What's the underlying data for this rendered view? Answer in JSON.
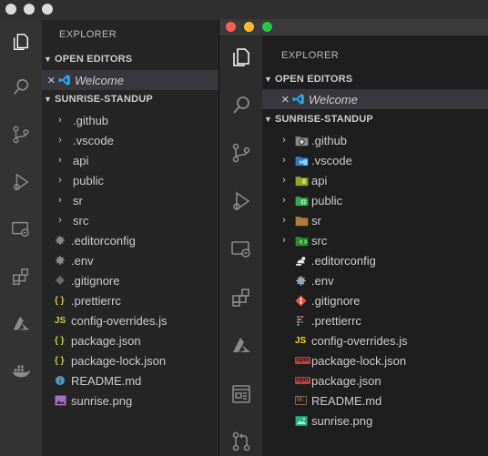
{
  "back_window": {
    "explorer_title": "EXPLORER",
    "open_editors_label": "OPEN EDITORS",
    "open_editor": {
      "close": "✕",
      "name": "Welcome"
    },
    "project_label": "SUNRISE-STANDUP",
    "folders": [
      ".github",
      ".vscode",
      "api",
      "public",
      "sr",
      "src"
    ],
    "files": [
      {
        "name": ".editorconfig",
        "icon": "gear-icon"
      },
      {
        "name": ".env",
        "icon": "gear-icon"
      },
      {
        "name": ".gitignore",
        "icon": "diamond-icon"
      },
      {
        "name": ".prettierrc",
        "icon": "braces-icon"
      },
      {
        "name": "config-overrides.js",
        "icon": "js-icon"
      },
      {
        "name": "package.json",
        "icon": "braces-icon"
      },
      {
        "name": "package-lock.json",
        "icon": "braces-icon"
      },
      {
        "name": "README.md",
        "icon": "info-icon"
      },
      {
        "name": "sunrise.png",
        "icon": "image-icon"
      }
    ]
  },
  "front_window": {
    "explorer_title": "EXPLORER",
    "open_editors_label": "OPEN EDITORS",
    "open_editor": {
      "close": "✕",
      "name": "Welcome"
    },
    "project_label": "SUNRISE-STANDUP",
    "folders": [
      ".github",
      ".vscode",
      "api",
      "public",
      "sr",
      "src"
    ],
    "files": [
      {
        "name": ".editorconfig",
        "icon": "editorconfig-icon"
      },
      {
        "name": ".env",
        "icon": "gear-icon"
      },
      {
        "name": ".gitignore",
        "icon": "git-icon"
      },
      {
        "name": ".prettierrc",
        "icon": "prettier-icon"
      },
      {
        "name": "config-overrides.js",
        "icon": "js-icon"
      },
      {
        "name": "package-lock.json",
        "icon": "npm-icon"
      },
      {
        "name": "package.json",
        "icon": "npm-icon"
      },
      {
        "name": "README.md",
        "icon": "markdown-icon"
      },
      {
        "name": "sunrise.png",
        "icon": "image-icon"
      }
    ]
  },
  "icon_glyphs": {
    "js": "JS",
    "braces": "{ }",
    "md": "M↓",
    "npm": "npm"
  },
  "colors": {
    "vscode_blue": "#23a8f2",
    "js_yellow": "#cbcb41",
    "traffic_red": "#fe5f57",
    "traffic_yellow": "#febc2e",
    "traffic_green": "#28c840"
  }
}
